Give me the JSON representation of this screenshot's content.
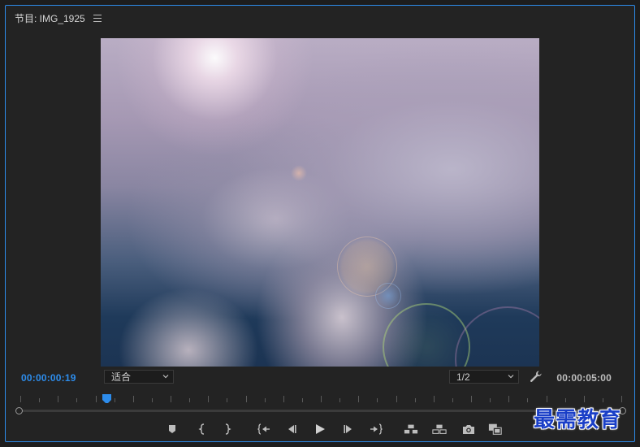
{
  "panel": {
    "title": "节目: IMG_1925",
    "accent_color": "#2d8ceb"
  },
  "viewer": {
    "description_icon": "video-frame"
  },
  "timecodes": {
    "current": "00:00:00:19",
    "duration": "00:00:05:00"
  },
  "fit_select": {
    "value": "适合"
  },
  "resolution_select": {
    "value": "1/2"
  },
  "transport": {
    "buttons": [
      "add-marker-icon",
      "mark-in-icon",
      "mark-out-icon",
      "go-to-in-icon",
      "step-back-icon",
      "play-icon",
      "step-forward-icon",
      "go-to-out-icon",
      "lift-icon",
      "extract-icon",
      "export-frame-icon",
      "comparison-view-icon"
    ]
  },
  "watermark": {
    "text": "最需教育"
  }
}
